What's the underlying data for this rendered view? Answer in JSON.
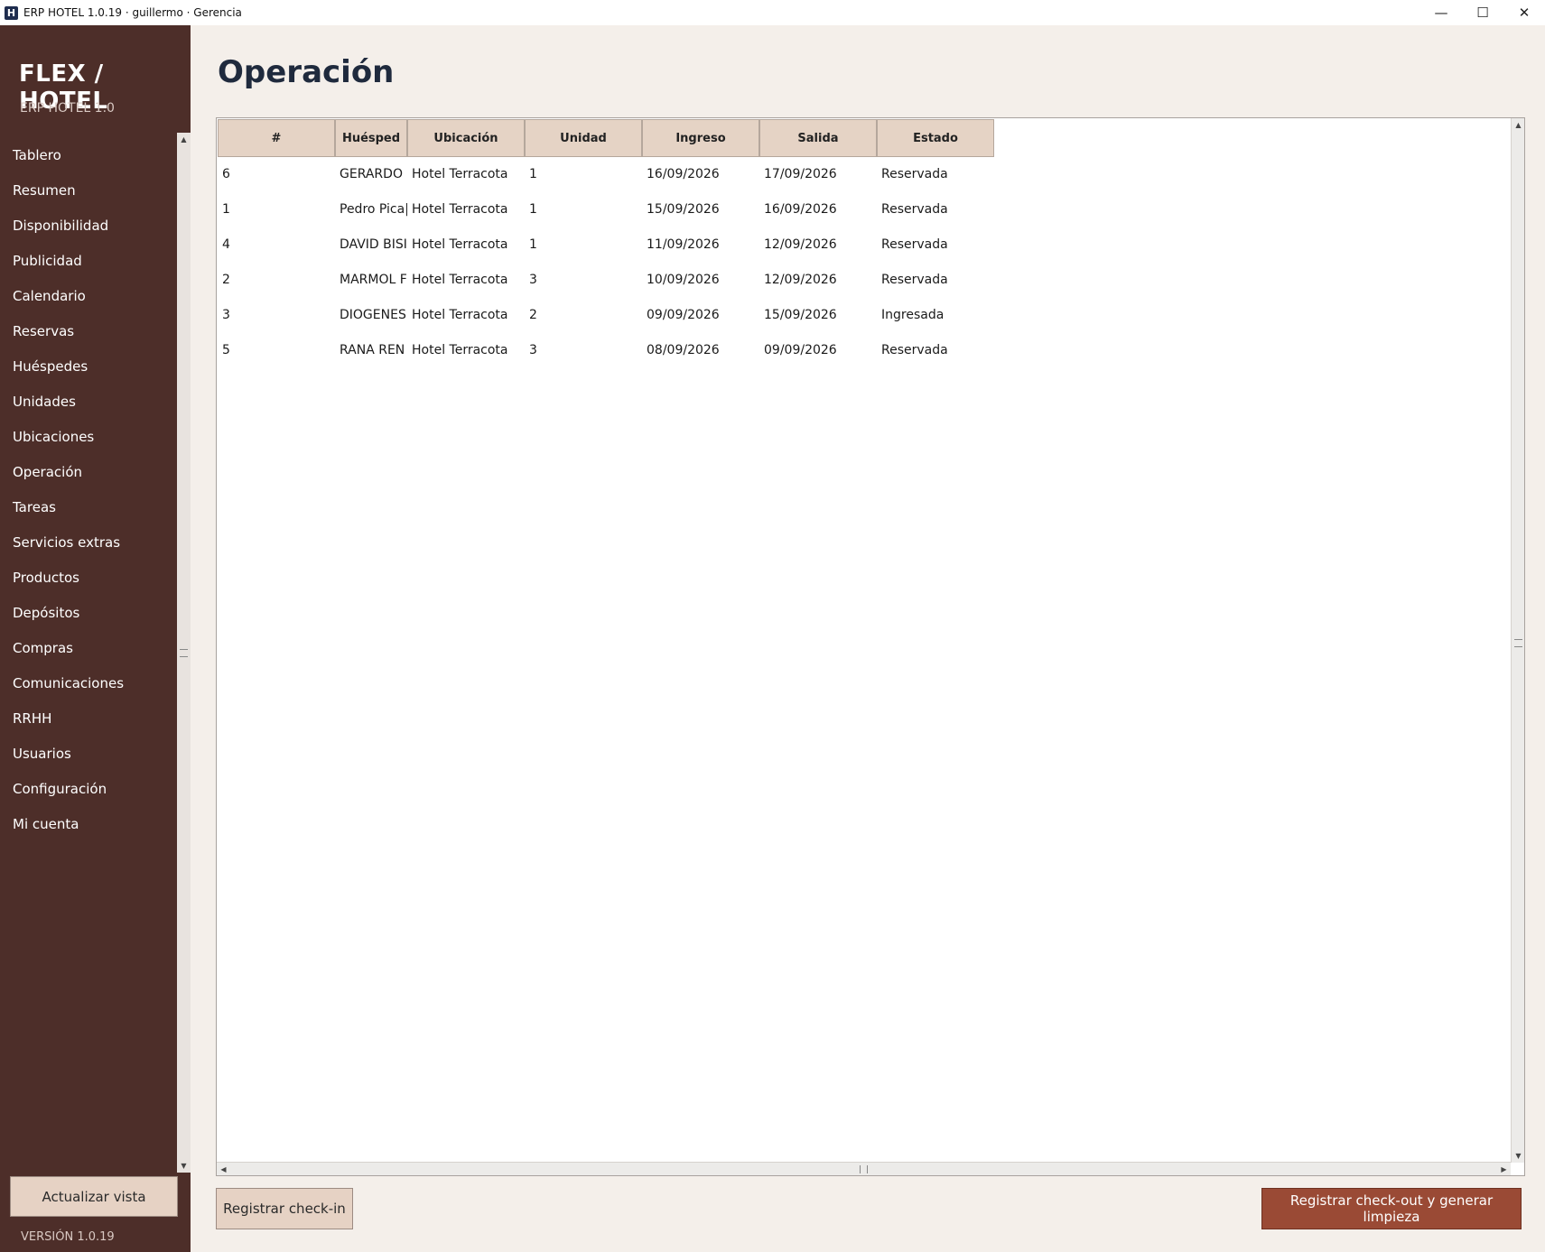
{
  "window": {
    "icon_letter": "H",
    "title": "ERP HOTEL 1.0.19 · guillermo · Gerencia",
    "minimize": "—",
    "maximize": "☐",
    "close": "✕"
  },
  "sidebar": {
    "brand": "FLEX / HOTEL",
    "subtitle": "ERP HOTEL 1.0",
    "items": [
      {
        "label": "Tablero"
      },
      {
        "label": "Resumen"
      },
      {
        "label": "Disponibilidad"
      },
      {
        "label": "Publicidad"
      },
      {
        "label": "Calendario"
      },
      {
        "label": "Reservas"
      },
      {
        "label": "Huéspedes"
      },
      {
        "label": "Unidades"
      },
      {
        "label": "Ubicaciones"
      },
      {
        "label": "Operación"
      },
      {
        "label": "Tareas"
      },
      {
        "label": "Servicios extras"
      },
      {
        "label": "Productos"
      },
      {
        "label": "Depósitos"
      },
      {
        "label": "Compras"
      },
      {
        "label": "Comunicaciones"
      },
      {
        "label": "RRHH"
      },
      {
        "label": "Usuarios"
      },
      {
        "label": "Configuración"
      },
      {
        "label": "Mi cuenta"
      }
    ],
    "refresh_label": "Actualizar vista",
    "version": "VERSIÓN 1.0.19"
  },
  "main": {
    "title": "Operación",
    "table": {
      "headers": [
        "#",
        "Huésped",
        "Ubicación",
        "Unidad",
        "Ingreso",
        "Salida",
        "Estado"
      ],
      "rows": [
        [
          "6",
          "GERARDO",
          "Hotel Terracota",
          "1",
          "16/09/2026",
          "17/09/2026",
          "Reservada"
        ],
        [
          "1",
          "Pedro Pica|",
          "Hotel Terracota",
          "1",
          "15/09/2026",
          "16/09/2026",
          "Reservada"
        ],
        [
          "4",
          "DAVID BISI",
          "Hotel Terracota",
          "1",
          "11/09/2026",
          "12/09/2026",
          "Reservada"
        ],
        [
          "2",
          "MARMOL F",
          "Hotel Terracota",
          "3",
          "10/09/2026",
          "12/09/2026",
          "Reservada"
        ],
        [
          "3",
          "DIOGENES",
          "Hotel Terracota",
          "2",
          "09/09/2026",
          "15/09/2026",
          "Ingresada"
        ],
        [
          "5",
          "RANA REN",
          "Hotel Terracota",
          "3",
          "08/09/2026",
          "09/09/2026",
          "Reservada"
        ]
      ]
    },
    "checkin_label": "Registrar check-in",
    "checkout_label": "Registrar check-out y generar limpieza"
  },
  "colors": {
    "sidebar_bg": "#4d2e29",
    "accent": "#9a4a35",
    "header_bg": "#e5d3c5",
    "page_bg": "#f4efea"
  }
}
